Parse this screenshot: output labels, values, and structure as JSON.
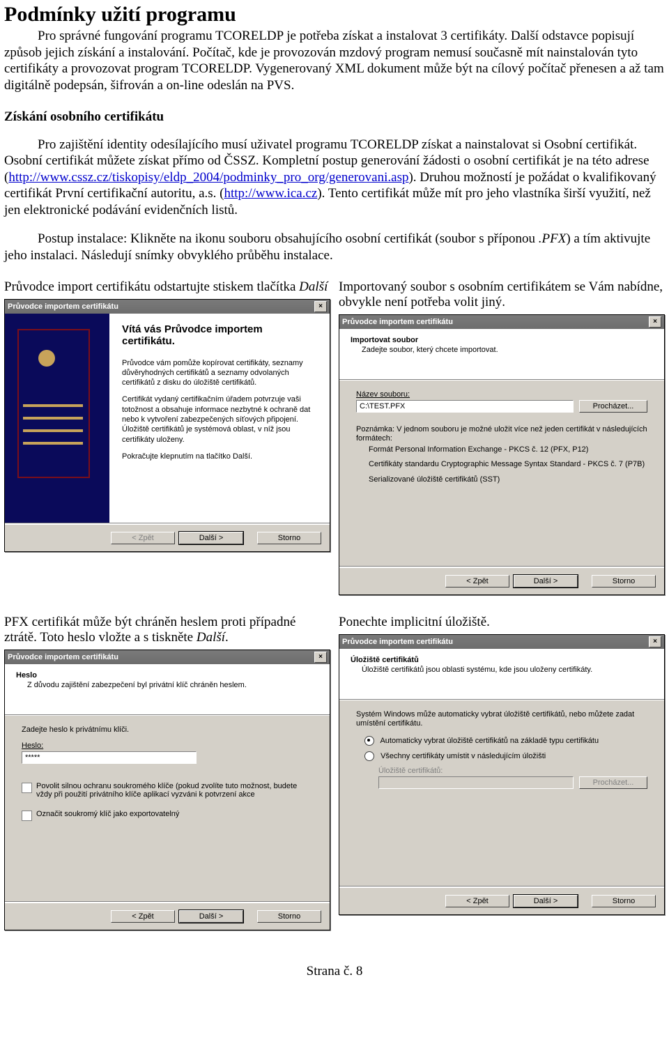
{
  "title": "Podmínky užití programu",
  "para1a": "Pro správné fungování programu TCORELDP je potřeba získat a instalovat 3 certifikáty. Další odstavce popisují způsob jejich získání a instalování. Počítač, kde je provozován mzdový program nemusí současně mít nainstalován tyto certifikáty a provozovat program TCORELDP. Vygenerovaný XML dokument může být na cílový počítač přenesen a až tam digitálně podepsán, šifrován a on-line odeslán na PVS.",
  "section1_title": "Získání osobního certifikátu",
  "para2a": "Pro zajištění identity odesílajícího musí uživatel programu TCORELDP získat a nainstalovat si Osobní certifikát. Osobní certifikát můžete získat přímo od ČSSZ. Kompletní postup  generování žádosti o osobní certifikát je na této adrese (",
  "link1_text": "http://www.cssz.cz/tiskopisy/eldp_2004/podminky_pro_org/generovani.asp",
  "para2b": "). Druhou možností je požádat o kvalifikovaný certifikát První certifikační autoritu, a.s. (",
  "link2_text": "http://www.ica.cz",
  "para2c": "). Tento certifikát může mít pro jeho vlastníka širší využití, než jen elektronické podávání evidenčních listů.",
  "para3a": "Postup instalace: Klikněte na ikonu souboru obsahujícího osobní certifikát (soubor s příponou ",
  "para3b": ".PFX",
  "para3c": ") a tím aktivujte jeho instalaci. Následují snímky obvyklého průběhu instalace.",
  "cap_left1a": "Průvodce import certifikátu odstartujte stiskem tlačítka ",
  "cap_left1b": "Další",
  "cap_right1": "Importovaný soubor s osobním certifikátem se Vám nabídne, obvykle není potřeba volit jiný.",
  "cap_left2a": "PFX certifikát může být chráněn heslem proti případné ztrátě. Toto heslo vložte a s tiskněte ",
  "cap_left2b": "Další",
  "cap_left2c": ".",
  "cap_right2": "Ponechte implicitní úložiště.",
  "wizard_title": "Průvodce importem certifikátu",
  "welcome_heading": "Vítá vás Průvodce importem certifikátu.",
  "welcome_p1": "Průvodce vám pomůže kopírovat certifikáty, seznamy důvěryhodných certifikátů a seznamy odvolaných certifikátů z disku do úložiště certifikátů.",
  "welcome_p2": "Certifikát vydaný certifikačním úřadem potvrzuje vaši totožnost a obsahuje informace nezbytné k ochraně dat nebo k vytvoření zabezpečených síťových připojení. Úložiště certifikátů je systémová oblast, v níž jsou certifikáty uloženy.",
  "welcome_p3": "Pokračujte klepnutím na tlačítko Další.",
  "btn_back": "< Zpět",
  "btn_next": "Další >",
  "btn_cancel": "Storno",
  "btn_browse": "Procházet...",
  "import_head": "Importovat soubor",
  "import_sub": "Zadejte soubor, který chcete importovat.",
  "import_label_file": "Název souboru:",
  "import_file_value": "C:\\TEST.PFX",
  "import_note": "Poznámka: V jednom souboru je možné uložit více než jeden certifikát v následujících formátech:",
  "import_fmt1": "Formát Personal Information Exchange - PKCS č. 12 (PFX, P12)",
  "import_fmt2": "Certifikáty standardu Cryptographic Message Syntax Standard - PKCS č. 7 (P7B)",
  "import_fmt3": "Serializované úložiště certifikátů (SST)",
  "pwd_head": "Heslo",
  "pwd_sub": "Z důvodu zajištění zabezpečení byl privátní klíč chráněn heslem.",
  "pwd_prompt": "Zadejte heslo k privátnímu klíči.",
  "pwd_label": "Heslo:",
  "pwd_value": "*****",
  "pwd_chk1": "Povolit silnou ochranu soukromého klíče (pokud zvolíte tuto možnost, budete vždy při použití privátního klíče aplikací vyzváni k potvrzení akce",
  "pwd_chk2": "Označit soukromý klíč jako exportovatelný",
  "store_head": "Úložiště certifikátů",
  "store_sub": "Úložiště certifikátů jsou oblasti systému, kde jsou uloženy certifikáty.",
  "store_p1": "Systém Windows může automaticky vybrat úložiště certifikátů, nebo můžete zadat umístění certifikátu.",
  "store_opt1": "Automaticky vybrat úložiště certifikátů na základě typu certifikátu",
  "store_opt2": "Všechny certifikáty umístit v následujícím úložišti",
  "store_label_store": "Úložiště certifikátů:",
  "footer_pg": "Strana č. 8"
}
